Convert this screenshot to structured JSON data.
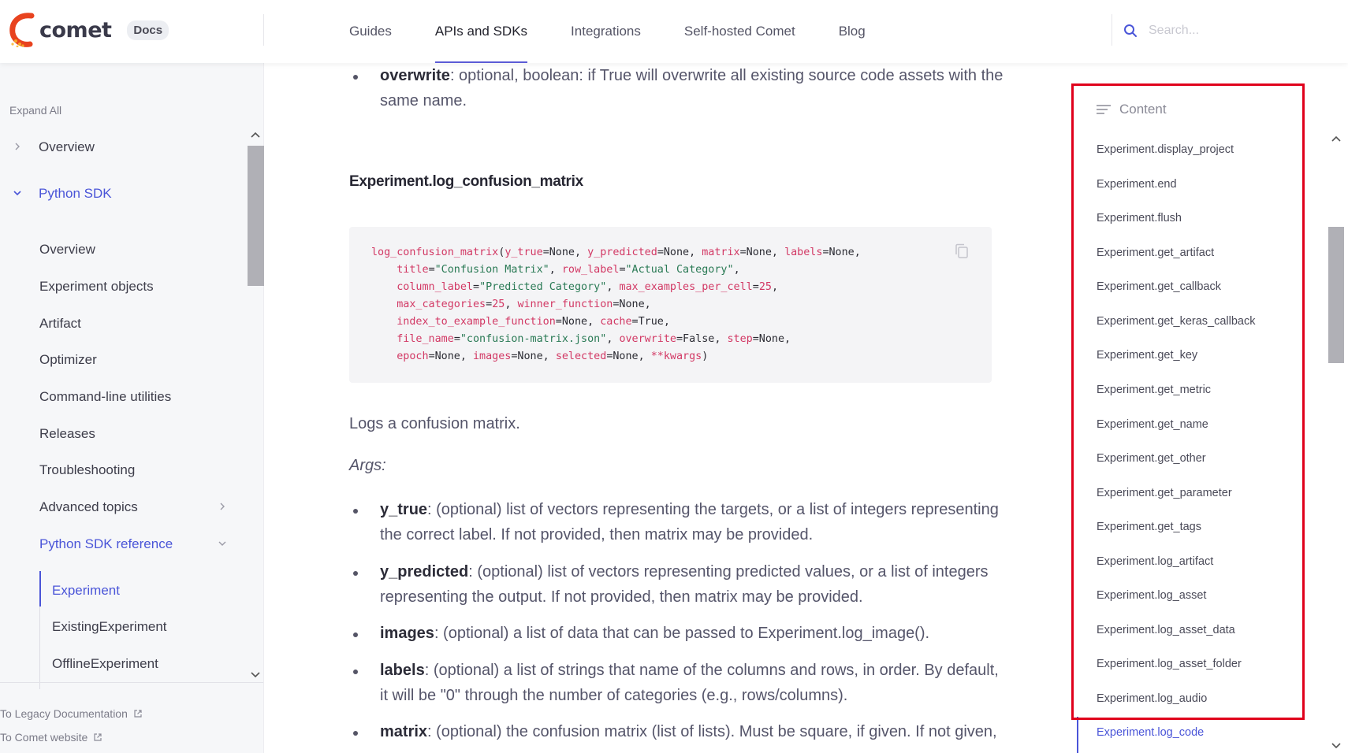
{
  "header": {
    "logo_text": "comet",
    "docs_badge": "Docs",
    "nav": [
      "Guides",
      "APIs and SDKs",
      "Integrations",
      "Self-hosted Comet",
      "Blog"
    ],
    "active_nav": "APIs and SDKs",
    "search_placeholder": "Search..."
  },
  "sidebar": {
    "expand_all": "Expand All",
    "overview_top": "Overview",
    "python_sdk": "Python SDK",
    "items": [
      "Overview",
      "Experiment objects",
      "Artifact",
      "Optimizer",
      "Command-line utilities",
      "Releases",
      "Troubleshooting",
      "Advanced topics"
    ],
    "sdk_reference": "Python SDK reference",
    "reference_items": [
      "Experiment",
      "ExistingExperiment",
      "OfflineExperiment"
    ],
    "footer_links": [
      "To Legacy Documentation",
      "To Comet website"
    ]
  },
  "main": {
    "overwrite_term": "overwrite",
    "overwrite_desc": ": optional, boolean: if True will overwrite all existing source code assets with the same name.",
    "heading": "Experiment.log_confusion_matrix",
    "description": "Logs a confusion matrix.",
    "args_label": "Args:",
    "args": [
      {
        "term": "y_true",
        "desc": ": (optional) list of vectors representing the targets, or a list of integers representing the correct label. If not provided, then matrix may be provided."
      },
      {
        "term": "y_predicted",
        "desc": ": (optional) list of vectors representing predicted values, or a list of integers representing the output. If not provided, then matrix may be provided."
      },
      {
        "term": "images",
        "desc": ": (optional) a list of data that can be passed to Experiment.log_image()."
      },
      {
        "term": "labels",
        "desc": ": (optional) a list of strings that name of the columns and rows, in order. By default, it will be \"0\" through the number of categories (e.g., rows/columns)."
      },
      {
        "term": "matrix",
        "desc": ": (optional) the confusion matrix (list of lists). Must be square, if given. If not given,"
      }
    ],
    "code_lines": [
      "log_confusion_matrix(y_true=None, y_predicted=None, matrix=None, labels=None,",
      "    title=\"Confusion Matrix\", row_label=\"Actual Category\",",
      "    column_label=\"Predicted Category\", max_examples_per_cell=25,",
      "    max_categories=25, winner_function=None,",
      "    index_to_example_function=None, cache=True,",
      "    file_name=\"confusion-matrix.json\", overwrite=False, step=None,",
      "    epoch=None, images=None, selected=None, **kwargs)"
    ]
  },
  "toc": {
    "title": "Content",
    "items": [
      "Experiment.display_project",
      "Experiment.end",
      "Experiment.flush",
      "Experiment.get_artifact",
      "Experiment.get_callback",
      "Experiment.get_keras_callback",
      "Experiment.get_key",
      "Experiment.get_metric",
      "Experiment.get_name",
      "Experiment.get_other",
      "Experiment.get_parameter",
      "Experiment.get_tags",
      "Experiment.log_artifact",
      "Experiment.log_asset",
      "Experiment.log_asset_data",
      "Experiment.log_asset_folder",
      "Experiment.log_audio",
      "Experiment.log_code"
    ],
    "active_item": "Experiment.log_code"
  },
  "colors": {
    "accent": "#4a55d8",
    "highlight_box": "#e0001b",
    "code_keyword": "#d23864",
    "code_string": "#2a7a55"
  }
}
